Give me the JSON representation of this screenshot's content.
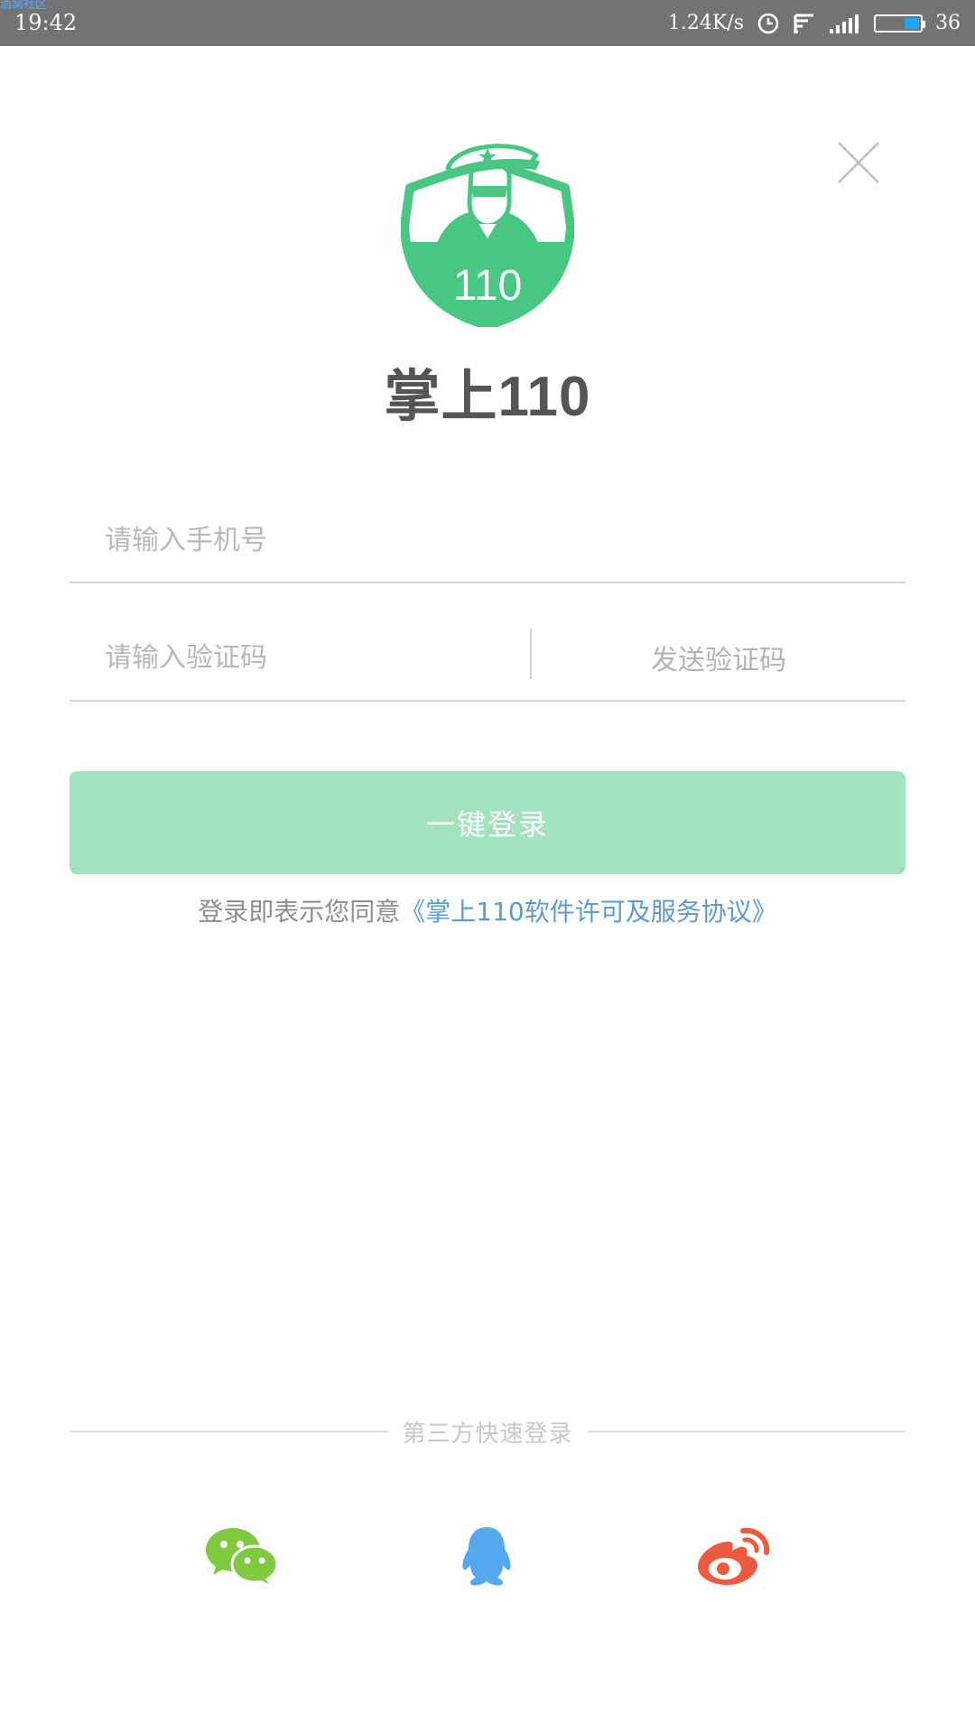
{
  "status_bar": {
    "tiny_label": "酒窝社区",
    "time": "19:42",
    "net_speed": "1.24K/s",
    "battery_level": "36",
    "colors": {
      "bar": "#737373",
      "battery_fill": "#19a7f6"
    }
  },
  "header": {
    "logo_number": "110",
    "app_title": "掌上110",
    "close_icon": "close-icon"
  },
  "form": {
    "phone_placeholder": "请输入手机号",
    "code_placeholder": "请输入验证码",
    "send_code_label": "发送验证码",
    "login_label": "一键登录",
    "agreement_prefix": "登录即表示您同意",
    "agreement_link": "《掌上110软件许可及服务协议》"
  },
  "third_party": {
    "label": "第三方快速登录",
    "providers": [
      {
        "name": "wechat-icon",
        "color": "#7ec93d"
      },
      {
        "name": "qq-icon",
        "color": "#54a9ee"
      },
      {
        "name": "weibo-icon",
        "color": "#ee5a3d"
      }
    ]
  },
  "theme": {
    "accent": "#48c783",
    "login_button": "#a2e3be",
    "link": "#5b9bd5"
  }
}
